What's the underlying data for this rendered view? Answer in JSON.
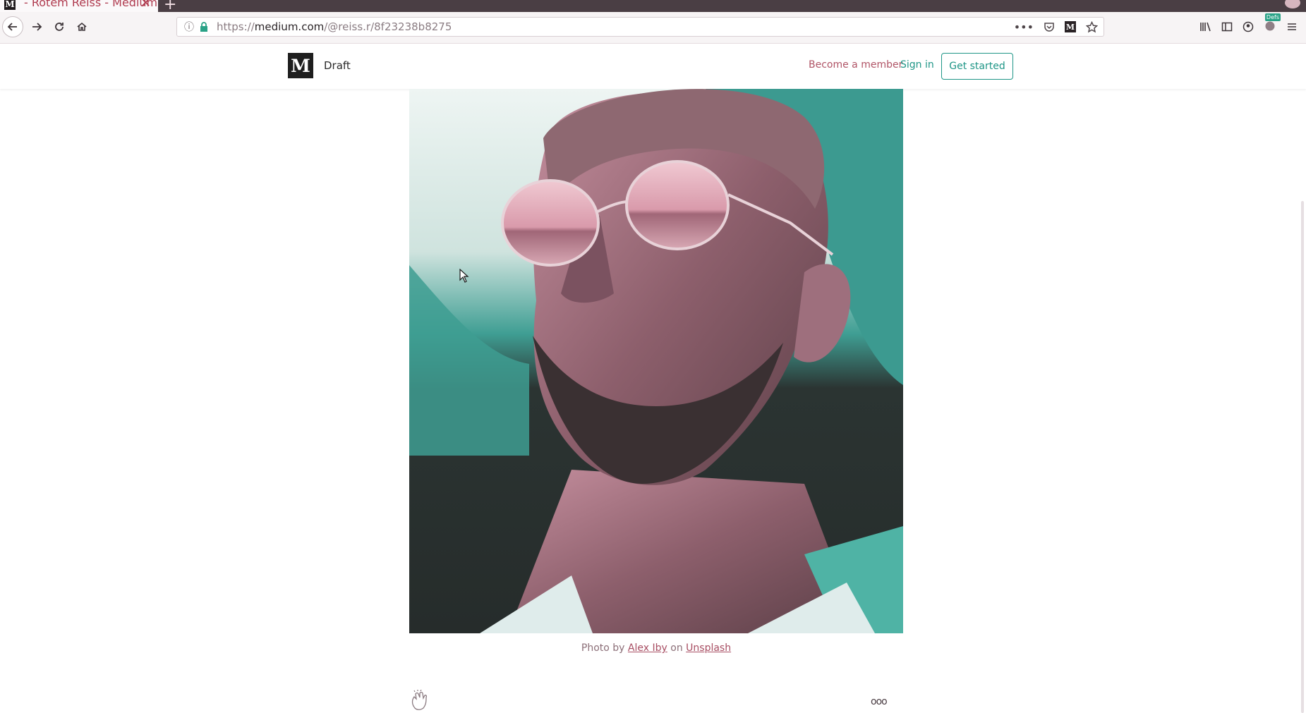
{
  "browser": {
    "tab_title": "- Rotem Reiss - Medium",
    "tab_favicon": "M",
    "tab_close": "✕",
    "new_tab": "+",
    "url_scheme": "https://",
    "url_host": "medium.com",
    "url_path": "/@reiss.r/8f23238b8275",
    "page_actions_icon": "•••",
    "extension_badge": "Defs"
  },
  "header": {
    "logo": "M",
    "status": "Draft",
    "become_member": "Become a member",
    "sign_in": "Sign in",
    "get_started": "Get started"
  },
  "article": {
    "caption_prefix": "Photo by",
    "photographer": "Alex Iby",
    "caption_mid": "on",
    "source": "Unsplash",
    "more_icon": "ooo"
  },
  "colors": {
    "accent_teal": "#1f9687",
    "accent_pink": "#b05466",
    "tab_strip": "#4a3e44"
  }
}
